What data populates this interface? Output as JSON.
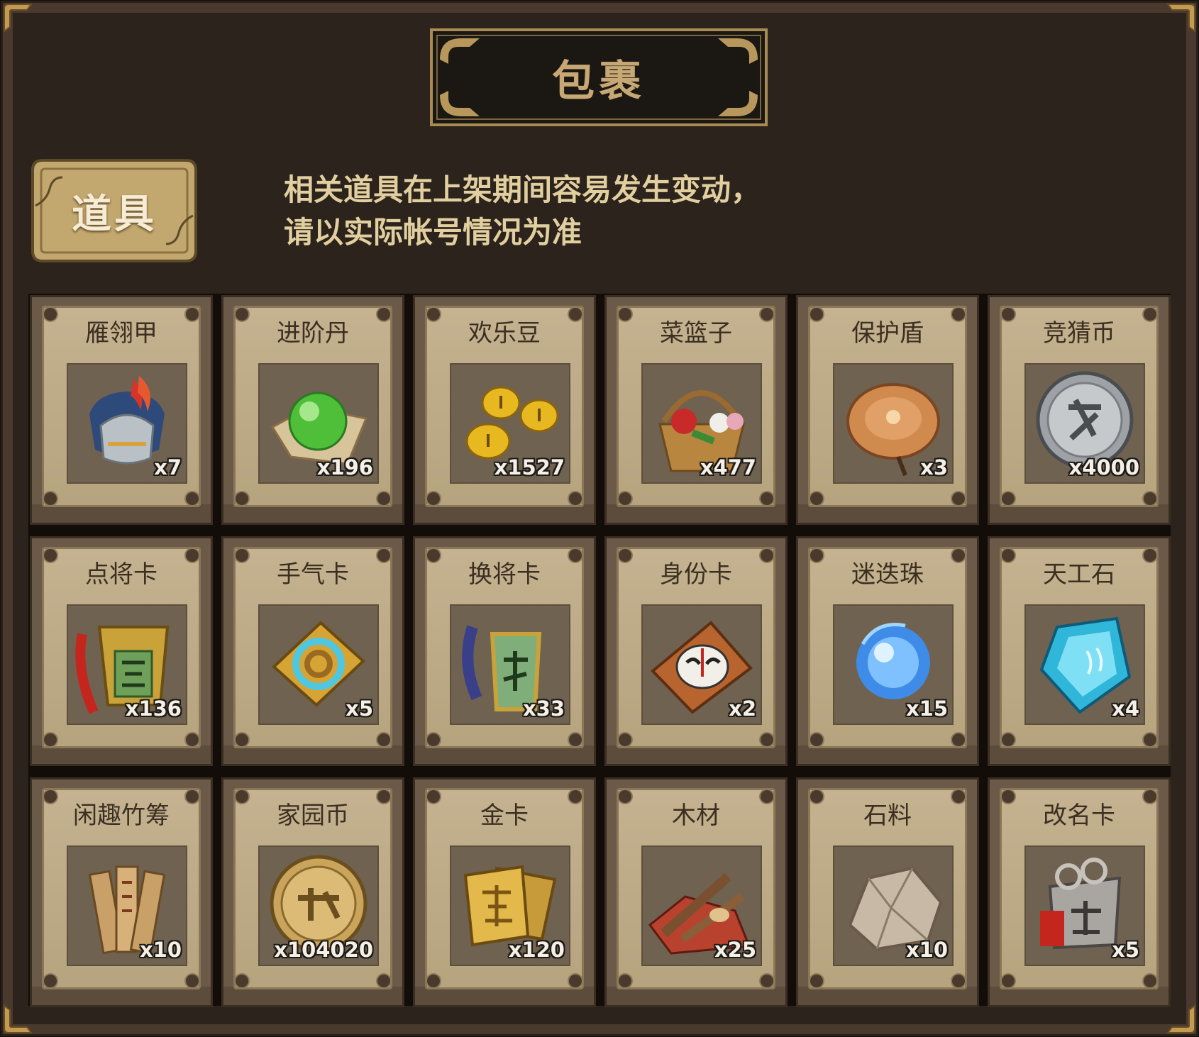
{
  "window": {
    "title": "包裹",
    "active_tab": "道具"
  },
  "notice": {
    "line1": "相关道具在上架期间容易发生变动，",
    "line2": "请以实际帐号情况为准"
  },
  "items": [
    {
      "name": "雁翎甲",
      "count": "x7",
      "icon": "armor-helmet-icon"
    },
    {
      "name": "进阶丹",
      "count": "x196",
      "icon": "green-orb-icon"
    },
    {
      "name": "欢乐豆",
      "count": "x1527",
      "icon": "gold-beans-icon"
    },
    {
      "name": "菜篮子",
      "count": "x477",
      "icon": "flower-basket-icon"
    },
    {
      "name": "保护盾",
      "count": "x3",
      "icon": "round-shield-icon"
    },
    {
      "name": "竞猜币",
      "count": "x4000",
      "icon": "silver-coin-icon"
    },
    {
      "name": "点将卡",
      "count": "x136",
      "icon": "general-token-icon"
    },
    {
      "name": "手气卡",
      "count": "x5",
      "icon": "refresh-card-icon"
    },
    {
      "name": "换将卡",
      "count": "x33",
      "icon": "swap-token-icon"
    },
    {
      "name": "身份卡",
      "count": "x2",
      "icon": "mask-card-icon"
    },
    {
      "name": "迷迭珠",
      "count": "x15",
      "icon": "blue-orb-icon"
    },
    {
      "name": "天工石",
      "count": "x4",
      "icon": "blue-crystal-icon"
    },
    {
      "name": "闲趣竹筹",
      "count": "x10",
      "icon": "bamboo-tally-icon"
    },
    {
      "name": "家园币",
      "count": "x104020",
      "icon": "gold-coin-icon"
    },
    {
      "name": "金卡",
      "count": "x120",
      "icon": "gold-card-icon"
    },
    {
      "name": "木材",
      "count": "x25",
      "icon": "wood-logs-icon"
    },
    {
      "name": "石料",
      "count": "x10",
      "icon": "stone-icon"
    },
    {
      "name": "改名卡",
      "count": "x5",
      "icon": "rename-token-icon"
    }
  ],
  "colors": {
    "background": "#2b231c",
    "title_text": "#c7a875",
    "notice_text": "#e2cf9f",
    "card_face": "#c4b290",
    "tab_gold": "#c2a86e"
  }
}
